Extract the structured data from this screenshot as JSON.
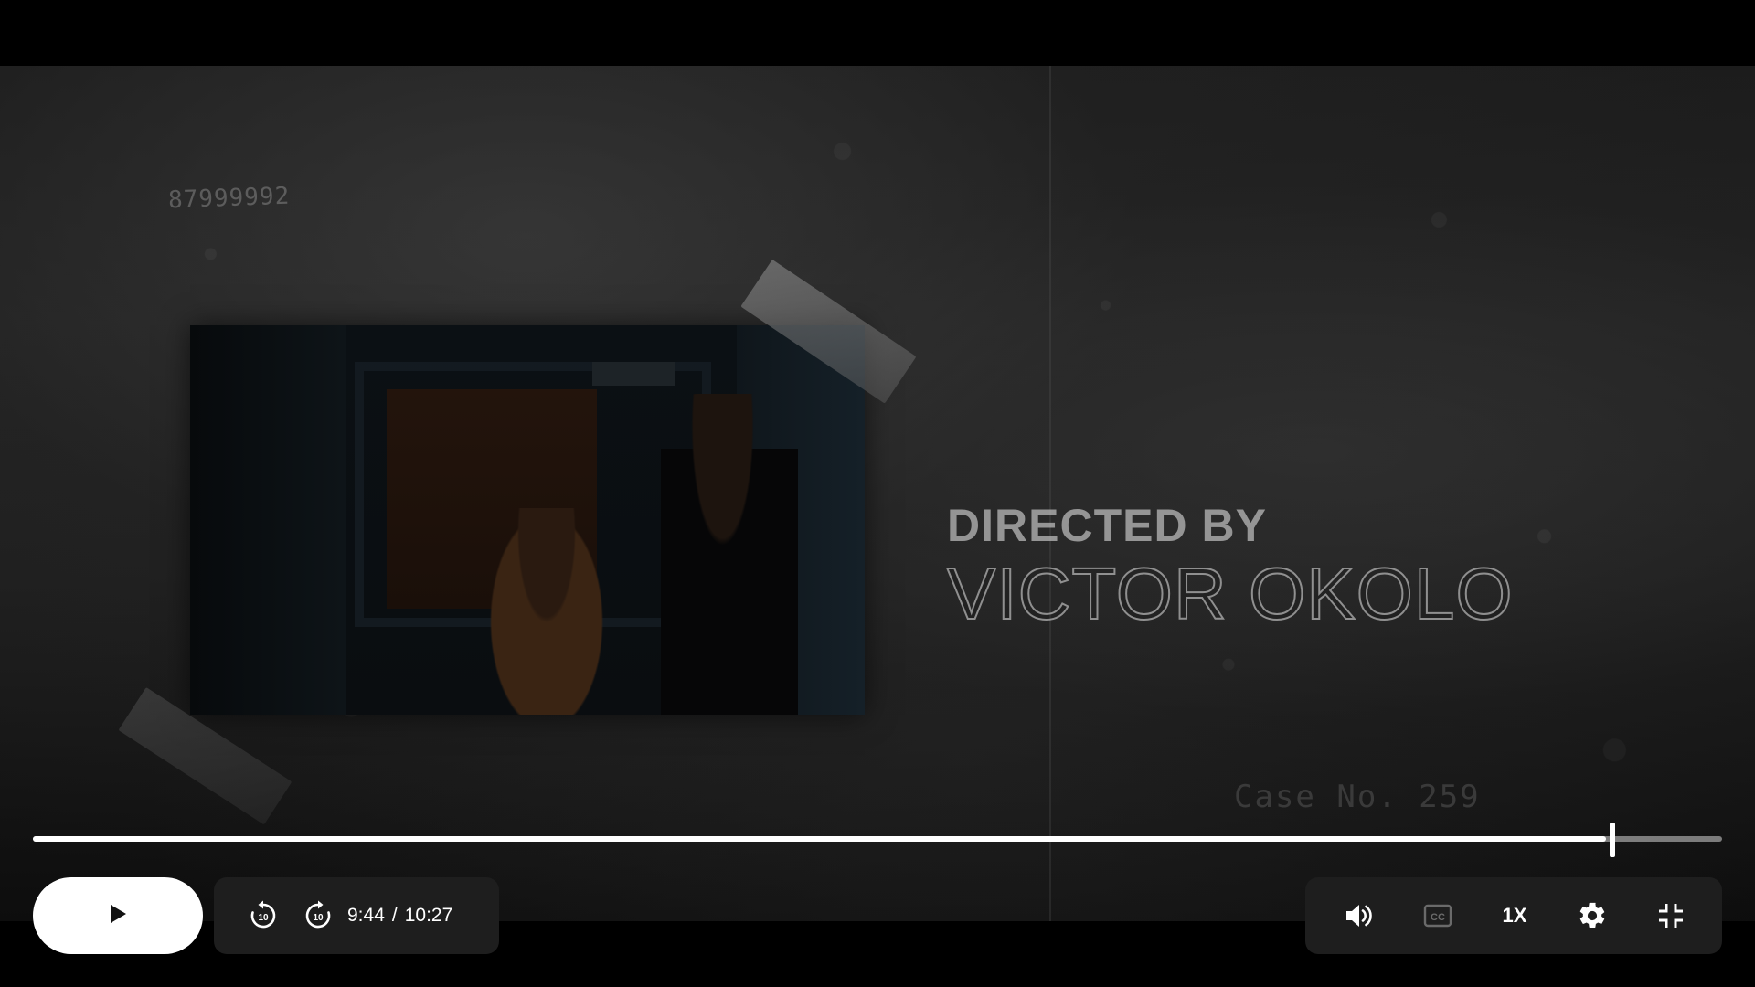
{
  "video": {
    "overlay_code": "87999992",
    "credit_label": "DIRECTED BY",
    "credit_name": "VICTOR OKOLO",
    "case_number": "Case No. 259"
  },
  "player": {
    "progress_fraction": 0.9313,
    "current_time": "9:44",
    "separator": "/",
    "duration": "10:27",
    "speed_label": "1X",
    "icons": {
      "play": "play-icon",
      "rewind": "rewind-10-icon",
      "forward": "forward-10-icon",
      "volume": "volume-icon",
      "captions": "captions-icon",
      "settings": "gear-icon",
      "fullscreen": "exit-fullscreen-icon"
    },
    "colors": {
      "progress_played": "#ffffff",
      "progress_remaining": "#aaaaaa",
      "control_bg": "#1e1e1e",
      "play_button_bg": "#ffffff"
    }
  }
}
